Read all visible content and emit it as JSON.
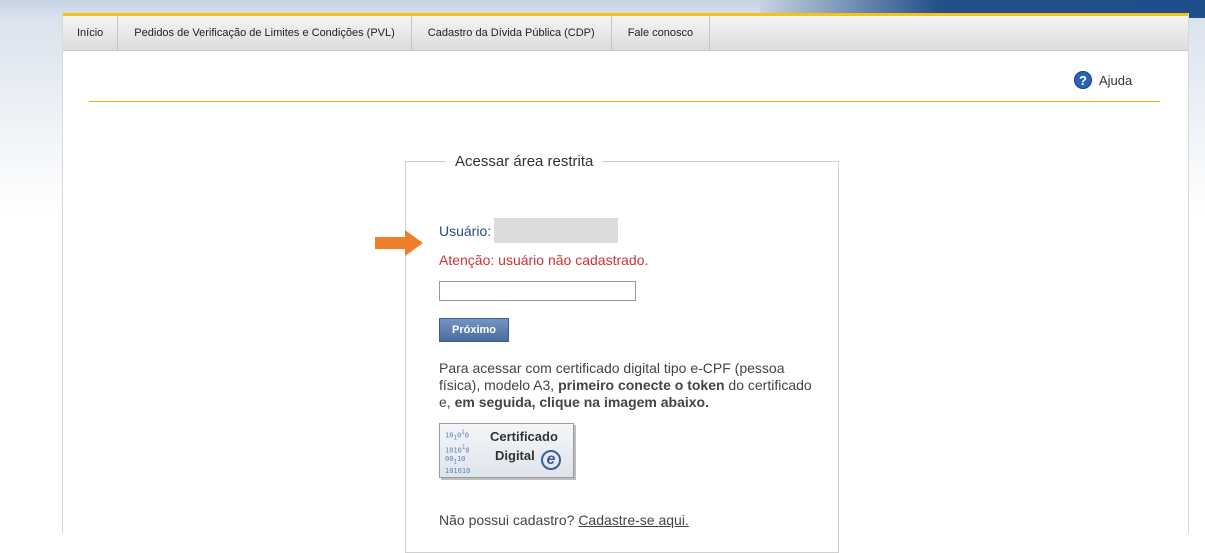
{
  "menu": {
    "items": [
      "Início",
      "Pedidos de Verificação de Limites e Condições (PVL)",
      "Cadastro da Dívida Pública (CDP)",
      "Fale conosco"
    ]
  },
  "help": {
    "label": "Ajuda",
    "icon": "question-icon"
  },
  "login": {
    "legend": "Acessar área restrita",
    "user_label": "Usuário:",
    "warning": "Atenção: usuário não cadastrado.",
    "next_button": "Próximo",
    "info_plain_1": "Para acessar com certificado digital tipo e-CPF (pessoa física), modelo A3, ",
    "info_bold_1": "primeiro conecte o token",
    "info_plain_2": " do certificado e, ",
    "info_bold_2": "em seguida, clique na imagem abaixo.",
    "cert_line1": "Certificado",
    "cert_line2": "Digital",
    "cert_e": "e",
    "signup_text": "Não possui cadastro?",
    "signup_link": "Cadastre-se aqui."
  },
  "colors": {
    "accent_yellow": "#f0c419",
    "warning_red": "#cc3333",
    "button_blue": "#4a6c9f",
    "arrow_orange": "#ee7d2c"
  }
}
